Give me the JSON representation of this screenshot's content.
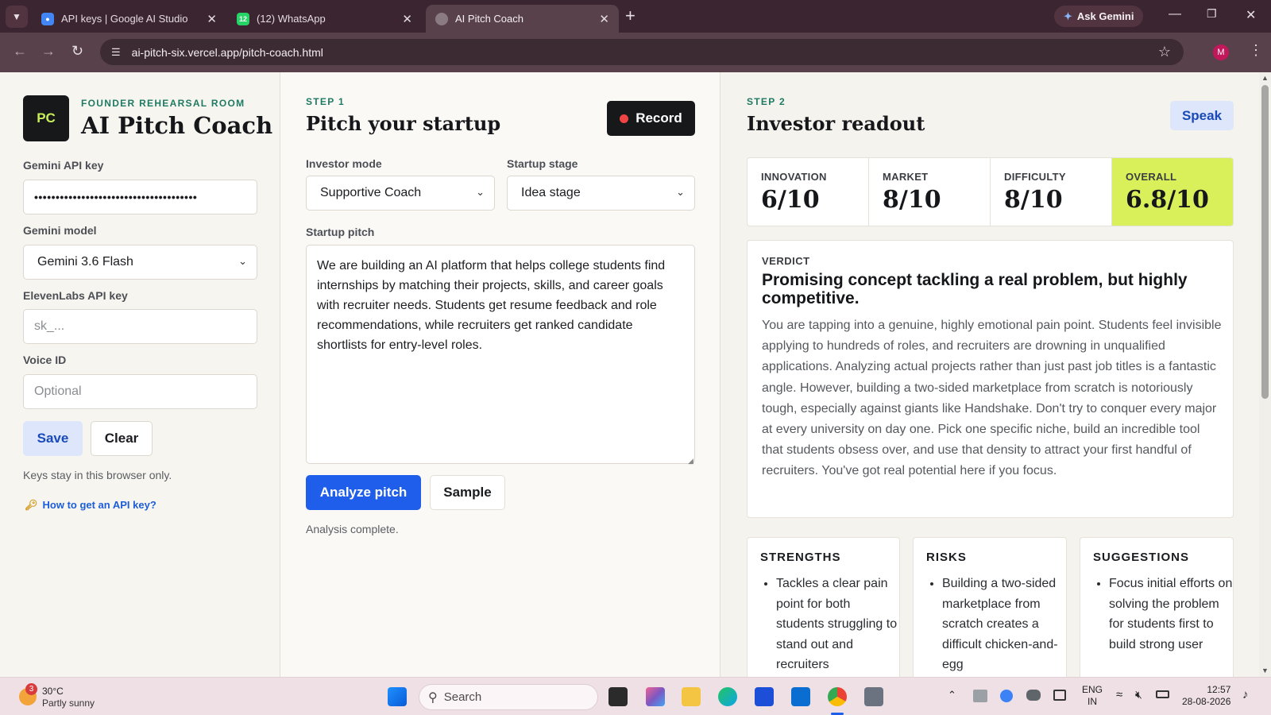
{
  "browser": {
    "tabs": [
      {
        "title": "API keys | Google AI Studio",
        "favicon": "google-ai-studio-icon"
      },
      {
        "title": "(12) WhatsApp",
        "favicon": "whatsapp-icon",
        "badge": "12"
      },
      {
        "title": "AI Pitch Coach",
        "favicon": "page-icon",
        "active": true
      }
    ],
    "ask_gemini": "Ask Gemini",
    "url": "ai-pitch-six.vercel.app/pitch-coach.html",
    "profile_initial": "M"
  },
  "sidebar": {
    "logo": "PC",
    "eyebrow": "FOUNDER REHEARSAL ROOM",
    "title": "AI Pitch Coach",
    "gemini_key_label": "Gemini API key",
    "gemini_key_value": "••••••••••••••••••••••••••••••••••••••",
    "gemini_model_label": "Gemini model",
    "gemini_model_value": "Gemini 3.6 Flash",
    "elevenlabs_label": "ElevenLabs API key",
    "elevenlabs_placeholder": "sk_...",
    "voice_label": "Voice ID",
    "voice_placeholder": "Optional",
    "save": "Save",
    "clear": "Clear",
    "note": "Keys stay in this browser only.",
    "help_link": "How to get an API key?"
  },
  "pitch": {
    "step": "STEP 1",
    "title": "Pitch your startup",
    "record": "Record",
    "investor_mode_label": "Investor mode",
    "investor_mode_value": "Supportive Coach",
    "stage_label": "Startup stage",
    "stage_value": "Idea stage",
    "pitch_label": "Startup pitch",
    "pitch_text": "We are building an AI platform that helps college students find internships by matching their projects, skills, and career goals with recruiter needs. Students get resume feedback and role recommendations, while recruiters get ranked candidate shortlists for entry-level roles.",
    "analyze": "Analyze pitch",
    "sample": "Sample",
    "status": "Analysis complete."
  },
  "readout": {
    "step": "STEP 2",
    "title": "Investor readout",
    "speak": "Speak",
    "metrics": [
      {
        "label": "INNOVATION",
        "value": "6/10"
      },
      {
        "label": "MARKET",
        "value": "8/10"
      },
      {
        "label": "DIFFICULTY",
        "value": "8/10"
      },
      {
        "label": "OVERALL",
        "value": "6.8/10"
      }
    ],
    "verdict_label": "VERDICT",
    "verdict_title": "Promising concept tackling a real problem, but highly competitive.",
    "verdict_body": "You are tapping into a genuine, highly emotional pain point. Students feel invisible applying to hundreds of roles, and recruiters are drowning in unqualified applications. Analyzing actual projects rather than just past job titles is a fantastic angle. However, building a two-sided marketplace from scratch is notoriously tough, especially against giants like Handshake. Don't try to conquer every major at every university on day one. Pick one specific niche, build an incredible tool that students obsess over, and use that density to attract your first handful of recruiters. You've got real potential here if you focus.",
    "strengths_title": "STRENGTHS",
    "strengths": [
      "Tackles a clear pain point for both students struggling to stand out and recruiters"
    ],
    "risks_title": "RISKS",
    "risks": [
      "Building a two-sided marketplace from scratch creates a difficult chicken-and-egg"
    ],
    "suggestions_title": "SUGGESTIONS",
    "suggestions": [
      "Focus initial efforts on solving the problem for students first to build strong user"
    ]
  },
  "taskbar": {
    "weather_temp": "30°C",
    "weather_desc": "Partly sunny",
    "weather_badge": "3",
    "search_placeholder": "Search",
    "lang_top": "ENG",
    "lang_bottom": "IN",
    "time": "12:57",
    "date": "28-08-2026"
  },
  "colors": {
    "accent_blue": "#1e5eea",
    "overall_highlight": "#d9f05a",
    "record_dark": "#17181a",
    "brand_green": "#1f7a63"
  }
}
